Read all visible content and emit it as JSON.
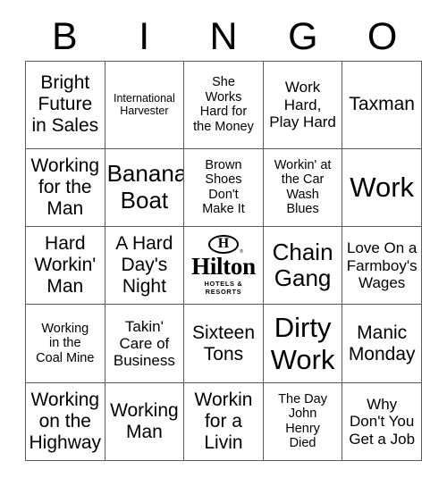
{
  "card": {
    "title": "BINGO",
    "header_letters": [
      "B",
      "I",
      "N",
      "G",
      "O"
    ],
    "border_color": "#5a5a5a",
    "text_color": "#000000",
    "background_color": "#ffffff"
  },
  "logo": {
    "name": "hilton-logo",
    "wordmark": "Hilton",
    "tagline": "HOTELS & RESORTS",
    "monogram": "H",
    "registered_mark": "®"
  },
  "rows": [
    [
      {
        "text": "Bright\nFuture\nin Sales",
        "size": "sz-l"
      },
      {
        "text": "International\nHarvester",
        "size": "sz-xs"
      },
      {
        "text": "She\nWorks\nHard for\nthe Money",
        "size": "sz-s"
      },
      {
        "text": "Work\nHard,\nPlay Hard",
        "size": "sz-m"
      },
      {
        "text": "Taxman",
        "size": "sz-l"
      }
    ],
    [
      {
        "text": "Working\nfor the\nMan",
        "size": "sz-l"
      },
      {
        "text": "Banana\nBoat",
        "size": "sz-xl"
      },
      {
        "text": "Brown\nShoes\nDon't\nMake It",
        "size": "sz-s"
      },
      {
        "text": "Workin' at\nthe Car\nWash\nBlues",
        "size": "sz-s"
      },
      {
        "text": "Work",
        "size": "sz-xxl"
      }
    ],
    [
      {
        "text": "Hard\nWorkin'\nMan",
        "size": "sz-l"
      },
      {
        "text": "A Hard\nDay's\nNight",
        "size": "sz-l"
      },
      {
        "text": "",
        "size": "logo"
      },
      {
        "text": "Chain\nGang",
        "size": "sz-xl"
      },
      {
        "text": "Love On a\nFarmboy's\nWages",
        "size": "sz-m"
      }
    ],
    [
      {
        "text": "Working\nin the\nCoal Mine",
        "size": "sz-s"
      },
      {
        "text": "Takin'\nCare of\nBusiness",
        "size": "sz-m"
      },
      {
        "text": "Sixteen\nTons",
        "size": "sz-l"
      },
      {
        "text": "Dirty\nWork",
        "size": "sz-xxl"
      },
      {
        "text": "Manic\nMonday",
        "size": "sz-l"
      }
    ],
    [
      {
        "text": "Working\non the\nHighway",
        "size": "sz-l"
      },
      {
        "text": "Working\nMan",
        "size": "sz-l"
      },
      {
        "text": "Workin\nfor a\nLivin",
        "size": "sz-l"
      },
      {
        "text": "The Day\nJohn\nHenry\nDied",
        "size": "sz-s"
      },
      {
        "text": "Why\nDon't You\nGet a Job",
        "size": "sz-m"
      }
    ]
  ]
}
